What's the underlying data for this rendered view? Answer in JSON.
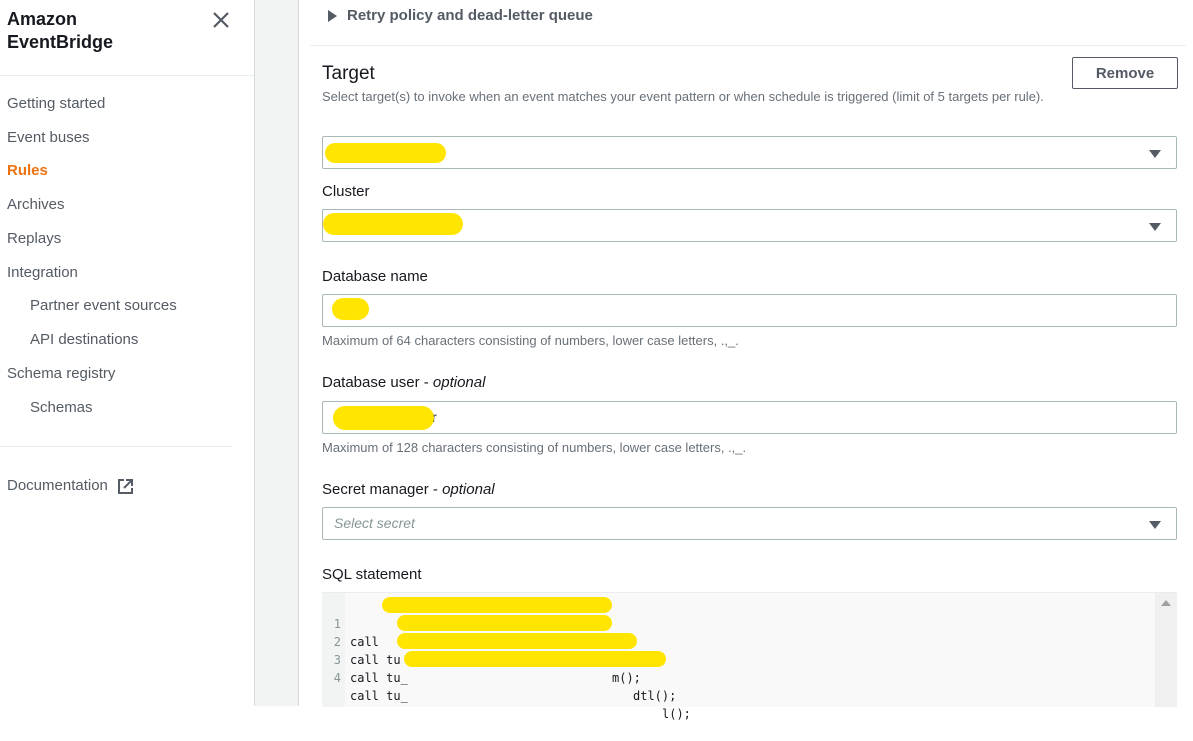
{
  "sidebar": {
    "title_line1": "Amazon",
    "title_line2": "EventBridge",
    "close_icon": "close-icon",
    "items": [
      {
        "label": "Getting started",
        "active": false,
        "sub": false
      },
      {
        "label": "Event buses",
        "active": false,
        "sub": false
      },
      {
        "label": "Rules",
        "active": true,
        "sub": false
      },
      {
        "label": "Archives",
        "active": false,
        "sub": false
      },
      {
        "label": "Replays",
        "active": false,
        "sub": false
      },
      {
        "label": "Integration",
        "active": false,
        "sub": false
      },
      {
        "label": "Partner event sources",
        "active": false,
        "sub": true
      },
      {
        "label": "API destinations",
        "active": false,
        "sub": true
      },
      {
        "label": "Schema registry",
        "active": false,
        "sub": false
      },
      {
        "label": "Schemas",
        "active": false,
        "sub": true
      }
    ],
    "documentation": {
      "label": "Documentation",
      "icon": "external-link-icon"
    }
  },
  "main": {
    "retry_expander": {
      "label": "Retry policy and dead-letter queue",
      "icon": "caret-right-icon"
    },
    "target": {
      "title": "Target",
      "description": "Select target(s) to invoke when an event matches your event pattern or when schedule is triggered (limit of 5 targets per rule).",
      "remove_label": "Remove",
      "target_select_value": "[redacted]"
    },
    "cluster": {
      "label": "Cluster",
      "value": "[redacted]"
    },
    "database_name": {
      "label": "Database name",
      "value": "[redacted]",
      "hint": "Maximum of 64 characters consisting of numbers, lower case letters, .,_."
    },
    "database_user": {
      "label": "Database user",
      "optional": "optional",
      "value_visible_suffix": "r",
      "hint": "Maximum of 128 characters consisting of numbers, lower case letters, .,_."
    },
    "secret_manager": {
      "label": "Secret manager",
      "optional": "optional",
      "placeholder": "Select secret"
    },
    "sql": {
      "label": "SQL statement",
      "lines": [
        {
          "num": "1",
          "prefix": "call ",
          "suffix": "m();"
        },
        {
          "num": "2",
          "prefix": "call tu",
          "suffix": "m();"
        },
        {
          "num": "3",
          "prefix": "call tu_",
          "suffix": "dtl();"
        },
        {
          "num": "4",
          "prefix": "call tu_",
          "suffix": "l();"
        }
      ]
    }
  },
  "colors": {
    "accent_active": "#ec7211",
    "redaction": "#ffe500"
  }
}
